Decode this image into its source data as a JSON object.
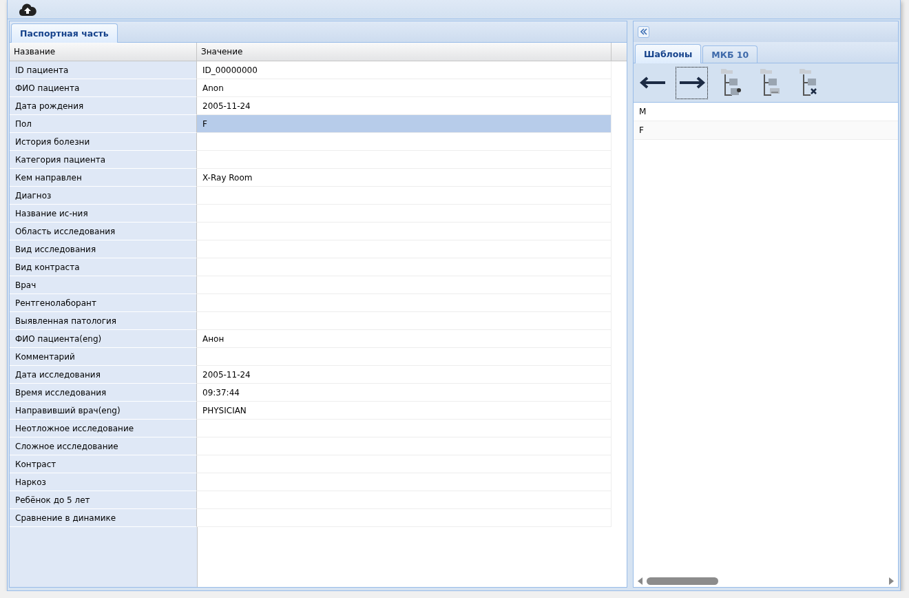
{
  "left_panel": {
    "tabs": [
      {
        "label": "Паспортная часть",
        "selected": true
      }
    ],
    "table": {
      "columns": [
        "Название",
        "Значение"
      ],
      "rows": [
        {
          "name": "ID пациента",
          "value": "ID_00000000",
          "selected": false
        },
        {
          "name": "ФИО пациента",
          "value": "Anon",
          "selected": false
        },
        {
          "name": "Дата рождения",
          "value": "2005-11-24",
          "selected": false
        },
        {
          "name": "Пол",
          "value": "F",
          "selected": true
        },
        {
          "name": "История болезни",
          "value": "",
          "selected": false
        },
        {
          "name": "Категория пациента",
          "value": "",
          "selected": false
        },
        {
          "name": "Кем направлен",
          "value": "X-Ray Room",
          "selected": false
        },
        {
          "name": "Диагноз",
          "value": "",
          "selected": false
        },
        {
          "name": "Название ис-ния",
          "value": "",
          "selected": false
        },
        {
          "name": "Область исследования",
          "value": "",
          "selected": false
        },
        {
          "name": "Вид исследования",
          "value": "",
          "selected": false
        },
        {
          "name": "Вид контраста",
          "value": "",
          "selected": false
        },
        {
          "name": "Врач",
          "value": "",
          "selected": false
        },
        {
          "name": "Рентгенолаборант",
          "value": "",
          "selected": false
        },
        {
          "name": "Выявленная патология",
          "value": "",
          "selected": false
        },
        {
          "name": "ФИО пациента(eng)",
          "value": "Анон",
          "selected": false
        },
        {
          "name": "Комментарий",
          "value": "",
          "selected": false
        },
        {
          "name": "Дата исследования",
          "value": "2005-11-24",
          "selected": false
        },
        {
          "name": "Время исследования",
          "value": "09:37:44",
          "selected": false
        },
        {
          "name": "Направивший врач(eng)",
          "value": "PHYSICIAN",
          "selected": false
        },
        {
          "name": "Неотложное исследование",
          "value": "",
          "selected": false
        },
        {
          "name": "Сложное исследование",
          "value": "",
          "selected": false
        },
        {
          "name": "Контраст",
          "value": "",
          "selected": false
        },
        {
          "name": "Наркоз",
          "value": "",
          "selected": false
        },
        {
          "name": "Ребёнок до 5 лет",
          "value": "",
          "selected": false
        },
        {
          "name": "Сравнение в динамике",
          "value": "",
          "selected": false
        }
      ]
    }
  },
  "right_panel": {
    "tabs": [
      {
        "label": "Шаблоны",
        "selected": true
      },
      {
        "label": "МКБ 10",
        "selected": false
      }
    ],
    "toolbar": [
      {
        "kind": "arrow-left",
        "focused": false
      },
      {
        "kind": "arrow-right",
        "focused": true
      },
      {
        "kind": "folder-gear",
        "focused": false
      },
      {
        "kind": "folder-text",
        "focused": false
      },
      {
        "kind": "folder-delete",
        "focused": false
      }
    ],
    "list": [
      "M",
      "F"
    ]
  }
}
